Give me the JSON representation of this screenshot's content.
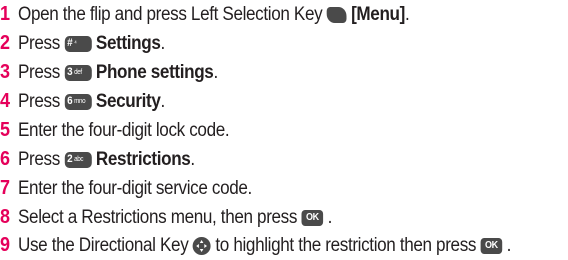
{
  "steps": [
    {
      "num": "1",
      "before": "Open the flip and press Left Selection Key",
      "bold": "[Menu]",
      "after": "."
    },
    {
      "num": "2",
      "before": "Press",
      "key_digit": "#",
      "key_letters": "⁴",
      "bold": "Settings",
      "after": "."
    },
    {
      "num": "3",
      "before": "Press",
      "key_digit": "3",
      "key_letters": "def",
      "bold": "Phone settings",
      "after": "."
    },
    {
      "num": "4",
      "before": "Press",
      "key_digit": "6",
      "key_letters": "mno",
      "bold": "Security",
      "after": "."
    },
    {
      "num": "5",
      "text": "Enter the four-digit lock code."
    },
    {
      "num": "6",
      "before": "Press",
      "key_digit": "2",
      "key_letters": "abc",
      "bold": "Restrictions",
      "after": "."
    },
    {
      "num": "7",
      "text": "Enter the four-digit service code."
    },
    {
      "num": "8",
      "before": "Select a Restrictions menu, then press",
      "key_label": "OK",
      "after": "."
    },
    {
      "num": "9",
      "before": "Use the Directional Key",
      "middle": "to highlight the restriction then press",
      "key_label": "OK",
      "after": "."
    }
  ],
  "icons": {
    "soft_key": "left-softkey-icon",
    "dpad": "directional-key-icon"
  },
  "colors": {
    "number": "#e5005a",
    "text": "#231f20",
    "key_bg": "#4a4a4a"
  }
}
